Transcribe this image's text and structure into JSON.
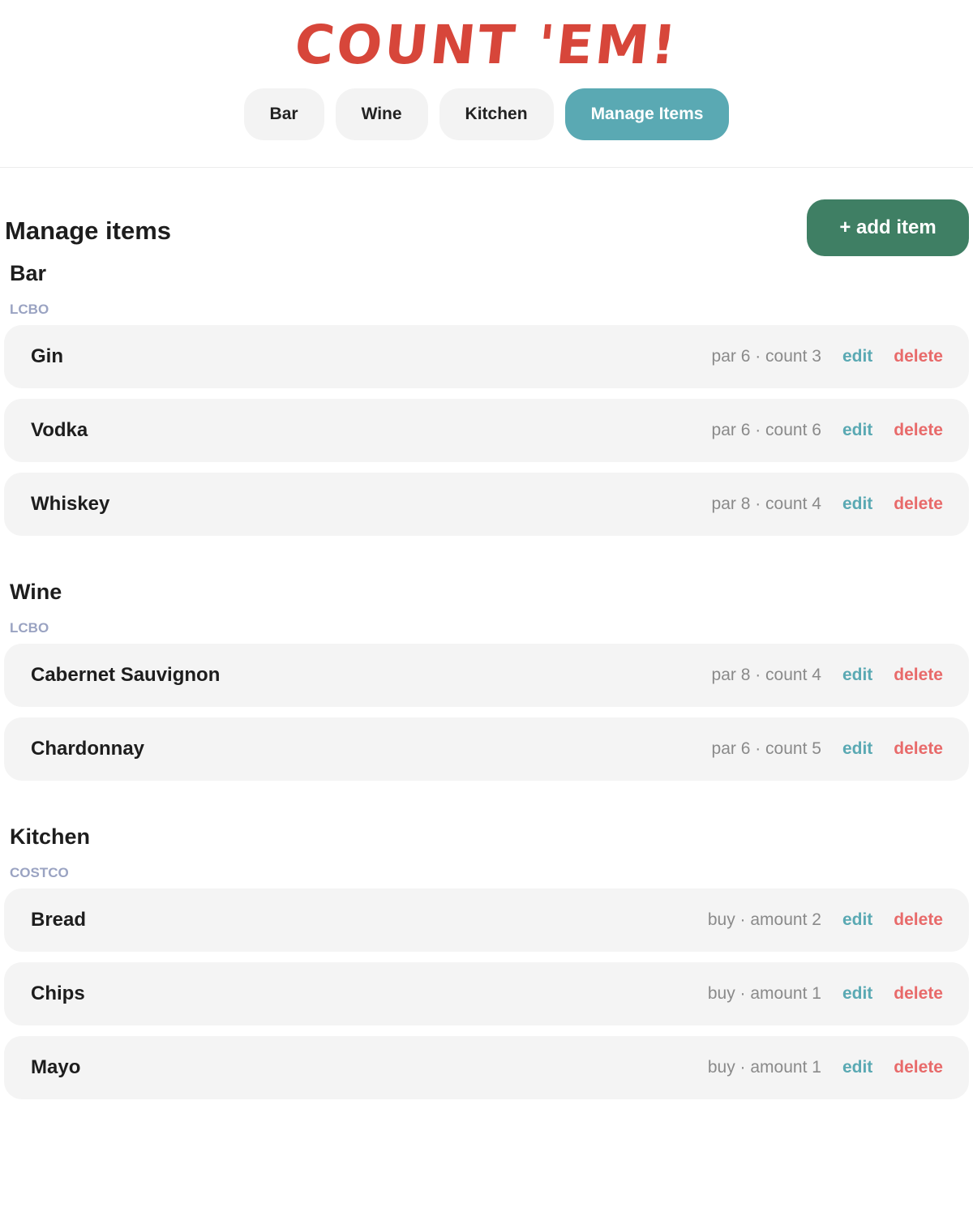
{
  "app": {
    "logo_text": "COUNT 'EM!",
    "logo_color": "#d7463a"
  },
  "nav": {
    "tabs": [
      {
        "label": "Bar",
        "active": false
      },
      {
        "label": "Wine",
        "active": false
      },
      {
        "label": "Kitchen",
        "active": false
      },
      {
        "label": "Manage Items",
        "active": true
      }
    ],
    "active_color": "#5aa9b3"
  },
  "page": {
    "title": "Manage items",
    "add_button_label": "+ add item",
    "add_button_color": "#3f7f64"
  },
  "actions": {
    "edit_label": "edit",
    "delete_label": "delete",
    "edit_color": "#5aa9b3",
    "delete_color": "#e86a6a"
  },
  "sections": [
    {
      "title": "Bar",
      "supplier": "LCBO",
      "items": [
        {
          "name": "Gin",
          "meta": "par 6 · count 3"
        },
        {
          "name": "Vodka",
          "meta": "par 6 · count 6"
        },
        {
          "name": "Whiskey",
          "meta": "par 8 · count 4"
        }
      ]
    },
    {
      "title": "Wine",
      "supplier": "LCBO",
      "items": [
        {
          "name": "Cabernet Sauvignon",
          "meta": "par 8 · count 4"
        },
        {
          "name": "Chardonnay",
          "meta": "par 6 · count 5"
        }
      ]
    },
    {
      "title": "Kitchen",
      "supplier": "COSTCO",
      "items": [
        {
          "name": "Bread",
          "meta": "buy · amount 2"
        },
        {
          "name": "Chips",
          "meta": "buy · amount 1"
        },
        {
          "name": "Mayo",
          "meta": "buy · amount 1"
        }
      ]
    }
  ]
}
